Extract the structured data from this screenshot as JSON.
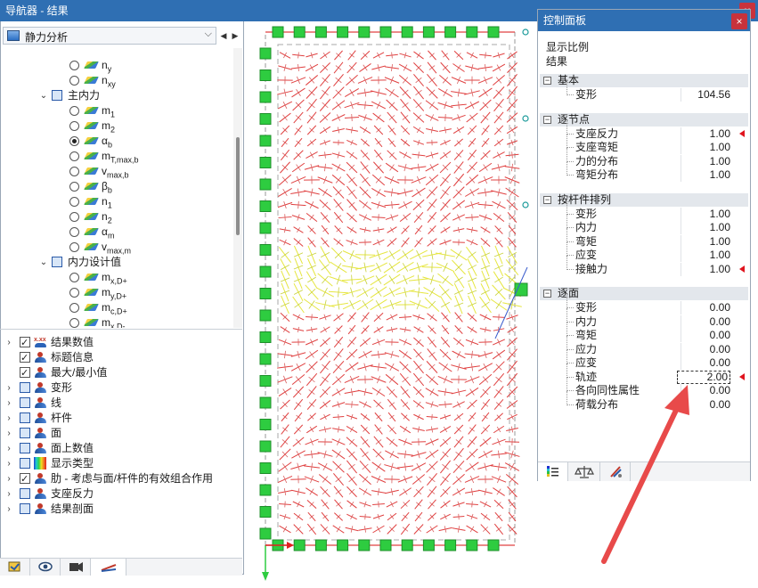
{
  "navigator": {
    "title": "导航器 - 结果",
    "close": "×",
    "analysis": "静力分析",
    "dropdown": "⌵",
    "prev": "◀",
    "next": "▶",
    "tree": [
      {
        "type": "radio",
        "label": "n",
        "sub": "y",
        "selected": false
      },
      {
        "type": "radio",
        "label": "n",
        "sub": "xy",
        "selected": false
      },
      {
        "type": "group",
        "label": "主内力"
      },
      {
        "type": "radio",
        "label": "m",
        "sub": "1",
        "selected": false
      },
      {
        "type": "radio",
        "label": "m",
        "sub": "2",
        "selected": false
      },
      {
        "type": "radio",
        "label": "α",
        "sub": "b",
        "selected": true
      },
      {
        "type": "radio",
        "label": "m",
        "sub": "T,max,b",
        "selected": false
      },
      {
        "type": "radio",
        "label": "v",
        "sub": "max,b",
        "selected": false
      },
      {
        "type": "radio",
        "label": "β",
        "sub": "b",
        "selected": false
      },
      {
        "type": "radio",
        "label": "n",
        "sub": "1",
        "selected": false
      },
      {
        "type": "radio",
        "label": "n",
        "sub": "2",
        "selected": false
      },
      {
        "type": "radio",
        "label": "α",
        "sub": "m",
        "selected": false
      },
      {
        "type": "radio",
        "label": "v",
        "sub": "max,m",
        "selected": false
      },
      {
        "type": "group",
        "label": "内力设计值"
      },
      {
        "type": "radio",
        "label": "m",
        "sub": "x,D+",
        "selected": false
      },
      {
        "type": "radio",
        "label": "m",
        "sub": "y,D+",
        "selected": false
      },
      {
        "type": "radio",
        "label": "m",
        "sub": "c,D+",
        "selected": false
      },
      {
        "type": "radio",
        "label": "m",
        "sub": "x,D-",
        "selected": false
      }
    ],
    "options": [
      {
        "label": "结果数值",
        "checked": true,
        "expander": true,
        "icon": "xxx"
      },
      {
        "label": "标题信息",
        "checked": true,
        "expander": false,
        "icon": "person"
      },
      {
        "label": "最大/最小值",
        "checked": true,
        "expander": false,
        "icon": "person"
      },
      {
        "label": "变形",
        "checked": false,
        "expander": true,
        "icon": "person"
      },
      {
        "label": "线",
        "checked": false,
        "expander": true,
        "icon": "person"
      },
      {
        "label": "杆件",
        "checked": false,
        "expander": true,
        "icon": "person"
      },
      {
        "label": "面",
        "checked": false,
        "expander": true,
        "icon": "person"
      },
      {
        "label": "面上数值",
        "checked": false,
        "expander": true,
        "icon": "person"
      },
      {
        "label": "显示类型",
        "checked": false,
        "expander": true,
        "icon": "rainbow"
      },
      {
        "label": "肋 - 考虑与面/杆件的有效组合作用",
        "checked": true,
        "expander": true,
        "icon": "person"
      },
      {
        "label": "支座反力",
        "checked": false,
        "expander": true,
        "icon": "person"
      },
      {
        "label": "结果剖面",
        "checked": false,
        "expander": true,
        "icon": "person"
      }
    ],
    "tab_icons": [
      "data-icon",
      "eye-icon",
      "camera-icon",
      "result-arrow-icon"
    ]
  },
  "control_panel": {
    "title": "控制面板",
    "close": "×",
    "subtitle1": "显示比例",
    "subtitle2": "结果",
    "sections": [
      {
        "title": "基本",
        "rows": [
          {
            "label": "变形",
            "value": "104.56",
            "marker": false,
            "edit": false
          }
        ]
      },
      {
        "title": "逐节点",
        "rows": [
          {
            "label": "支座反力",
            "value": "1.00",
            "marker": true,
            "edit": false
          },
          {
            "label": "支座弯矩",
            "value": "1.00",
            "marker": false,
            "edit": false
          },
          {
            "label": "力的分布",
            "value": "1.00",
            "marker": false,
            "edit": false
          },
          {
            "label": "弯矩分布",
            "value": "1.00",
            "marker": false,
            "edit": false
          }
        ]
      },
      {
        "title": "按杆件排列",
        "rows": [
          {
            "label": "变形",
            "value": "1.00",
            "marker": false,
            "edit": false
          },
          {
            "label": "内力",
            "value": "1.00",
            "marker": false,
            "edit": false
          },
          {
            "label": "弯矩",
            "value": "1.00",
            "marker": false,
            "edit": false
          },
          {
            "label": "应变",
            "value": "1.00",
            "marker": false,
            "edit": false
          },
          {
            "label": "接触力",
            "value": "1.00",
            "marker": true,
            "edit": false
          }
        ]
      },
      {
        "title": "逐面",
        "rows": [
          {
            "label": "变形",
            "value": "0.00",
            "marker": false,
            "edit": false
          },
          {
            "label": "内力",
            "value": "0.00",
            "marker": false,
            "edit": false
          },
          {
            "label": "弯矩",
            "value": "0.00",
            "marker": false,
            "edit": false
          },
          {
            "label": "应力",
            "value": "0.00",
            "marker": false,
            "edit": false
          },
          {
            "label": "应变",
            "value": "0.00",
            "marker": false,
            "edit": false
          },
          {
            "label": "轨迹",
            "value": "2.00",
            "marker": true,
            "edit": true
          },
          {
            "label": "各向同性属性",
            "value": "0.00",
            "marker": false,
            "edit": false
          },
          {
            "label": "荷载分布",
            "value": "0.00",
            "marker": false,
            "edit": false
          }
        ]
      }
    ],
    "tab_icons": [
      "color-scale-icon",
      "balance-icon",
      "pointer-icon"
    ]
  },
  "colors": {
    "title_bar": "#2f6fb3",
    "close": "#c8323c",
    "support": "#2ecc40",
    "trajectory_red": "#e04040",
    "trajectory_yellow": "#e6e640",
    "callout_arrow": "#e84a4a",
    "marker": "#e0141e"
  }
}
